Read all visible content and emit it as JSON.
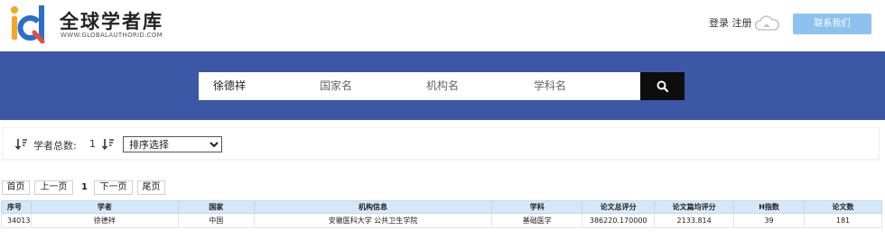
{
  "header": {
    "site_name": "全球学者库",
    "site_url": "WWW.GLOBALAUTHORID.COM",
    "login": "登录",
    "register": "注册",
    "contact_button": "联系我们",
    "logo_colors": [
      "#f5a623",
      "#2a6fc9",
      "#e94b3c"
    ]
  },
  "search": {
    "scholar_value": "徐德祥",
    "country_placeholder": "国家名",
    "institution_placeholder": "机构名",
    "subject_placeholder": "学科名",
    "button_icon": "search-icon",
    "band_color": "#3b57a5"
  },
  "filter": {
    "total_label": "学者总数:",
    "total_count": "1",
    "sort_select": "排序选择",
    "sort_icon": "sort-icon"
  },
  "pager": {
    "first": "首页",
    "prev": "上一页",
    "current": "1",
    "next": "下一页",
    "last": "尾页"
  },
  "table": {
    "headers": [
      "序号",
      "学者",
      "国家",
      "机构信息",
      "学科",
      "论文总评分",
      "论文篇均评分",
      "H指数",
      "论文数"
    ],
    "rows": [
      [
        "34013",
        "徐德祥",
        "中国",
        "安徽医科大学 公共卫生学院",
        "基础医学",
        "386220.170000",
        "2133.814",
        "39",
        "181"
      ]
    ]
  }
}
